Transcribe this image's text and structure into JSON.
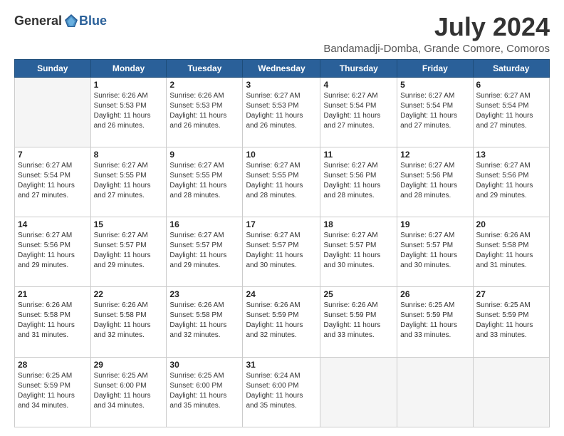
{
  "logo": {
    "general": "General",
    "blue": "Blue"
  },
  "title": {
    "month_year": "July 2024",
    "location": "Bandamadji-Domba, Grande Comore, Comoros"
  },
  "days_of_week": [
    "Sunday",
    "Monday",
    "Tuesday",
    "Wednesday",
    "Thursday",
    "Friday",
    "Saturday"
  ],
  "weeks": [
    [
      {
        "day": "",
        "info": ""
      },
      {
        "day": "1",
        "info": "Sunrise: 6:26 AM\nSunset: 5:53 PM\nDaylight: 11 hours\nand 26 minutes."
      },
      {
        "day": "2",
        "info": "Sunrise: 6:26 AM\nSunset: 5:53 PM\nDaylight: 11 hours\nand 26 minutes."
      },
      {
        "day": "3",
        "info": "Sunrise: 6:27 AM\nSunset: 5:53 PM\nDaylight: 11 hours\nand 26 minutes."
      },
      {
        "day": "4",
        "info": "Sunrise: 6:27 AM\nSunset: 5:54 PM\nDaylight: 11 hours\nand 27 minutes."
      },
      {
        "day": "5",
        "info": "Sunrise: 6:27 AM\nSunset: 5:54 PM\nDaylight: 11 hours\nand 27 minutes."
      },
      {
        "day": "6",
        "info": "Sunrise: 6:27 AM\nSunset: 5:54 PM\nDaylight: 11 hours\nand 27 minutes."
      }
    ],
    [
      {
        "day": "7",
        "info": "Sunrise: 6:27 AM\nSunset: 5:54 PM\nDaylight: 11 hours\nand 27 minutes."
      },
      {
        "day": "8",
        "info": "Sunrise: 6:27 AM\nSunset: 5:55 PM\nDaylight: 11 hours\nand 27 minutes."
      },
      {
        "day": "9",
        "info": "Sunrise: 6:27 AM\nSunset: 5:55 PM\nDaylight: 11 hours\nand 28 minutes."
      },
      {
        "day": "10",
        "info": "Sunrise: 6:27 AM\nSunset: 5:55 PM\nDaylight: 11 hours\nand 28 minutes."
      },
      {
        "day": "11",
        "info": "Sunrise: 6:27 AM\nSunset: 5:56 PM\nDaylight: 11 hours\nand 28 minutes."
      },
      {
        "day": "12",
        "info": "Sunrise: 6:27 AM\nSunset: 5:56 PM\nDaylight: 11 hours\nand 28 minutes."
      },
      {
        "day": "13",
        "info": "Sunrise: 6:27 AM\nSunset: 5:56 PM\nDaylight: 11 hours\nand 29 minutes."
      }
    ],
    [
      {
        "day": "14",
        "info": "Sunrise: 6:27 AM\nSunset: 5:56 PM\nDaylight: 11 hours\nand 29 minutes."
      },
      {
        "day": "15",
        "info": "Sunrise: 6:27 AM\nSunset: 5:57 PM\nDaylight: 11 hours\nand 29 minutes."
      },
      {
        "day": "16",
        "info": "Sunrise: 6:27 AM\nSunset: 5:57 PM\nDaylight: 11 hours\nand 29 minutes."
      },
      {
        "day": "17",
        "info": "Sunrise: 6:27 AM\nSunset: 5:57 PM\nDaylight: 11 hours\nand 30 minutes."
      },
      {
        "day": "18",
        "info": "Sunrise: 6:27 AM\nSunset: 5:57 PM\nDaylight: 11 hours\nand 30 minutes."
      },
      {
        "day": "19",
        "info": "Sunrise: 6:27 AM\nSunset: 5:57 PM\nDaylight: 11 hours\nand 30 minutes."
      },
      {
        "day": "20",
        "info": "Sunrise: 6:26 AM\nSunset: 5:58 PM\nDaylight: 11 hours\nand 31 minutes."
      }
    ],
    [
      {
        "day": "21",
        "info": "Sunrise: 6:26 AM\nSunset: 5:58 PM\nDaylight: 11 hours\nand 31 minutes."
      },
      {
        "day": "22",
        "info": "Sunrise: 6:26 AM\nSunset: 5:58 PM\nDaylight: 11 hours\nand 32 minutes."
      },
      {
        "day": "23",
        "info": "Sunrise: 6:26 AM\nSunset: 5:58 PM\nDaylight: 11 hours\nand 32 minutes."
      },
      {
        "day": "24",
        "info": "Sunrise: 6:26 AM\nSunset: 5:59 PM\nDaylight: 11 hours\nand 32 minutes."
      },
      {
        "day": "25",
        "info": "Sunrise: 6:26 AM\nSunset: 5:59 PM\nDaylight: 11 hours\nand 33 minutes."
      },
      {
        "day": "26",
        "info": "Sunrise: 6:25 AM\nSunset: 5:59 PM\nDaylight: 11 hours\nand 33 minutes."
      },
      {
        "day": "27",
        "info": "Sunrise: 6:25 AM\nSunset: 5:59 PM\nDaylight: 11 hours\nand 33 minutes."
      }
    ],
    [
      {
        "day": "28",
        "info": "Sunrise: 6:25 AM\nSunset: 5:59 PM\nDaylight: 11 hours\nand 34 minutes."
      },
      {
        "day": "29",
        "info": "Sunrise: 6:25 AM\nSunset: 6:00 PM\nDaylight: 11 hours\nand 34 minutes."
      },
      {
        "day": "30",
        "info": "Sunrise: 6:25 AM\nSunset: 6:00 PM\nDaylight: 11 hours\nand 35 minutes."
      },
      {
        "day": "31",
        "info": "Sunrise: 6:24 AM\nSunset: 6:00 PM\nDaylight: 11 hours\nand 35 minutes."
      },
      {
        "day": "",
        "info": ""
      },
      {
        "day": "",
        "info": ""
      },
      {
        "day": "",
        "info": ""
      }
    ]
  ]
}
